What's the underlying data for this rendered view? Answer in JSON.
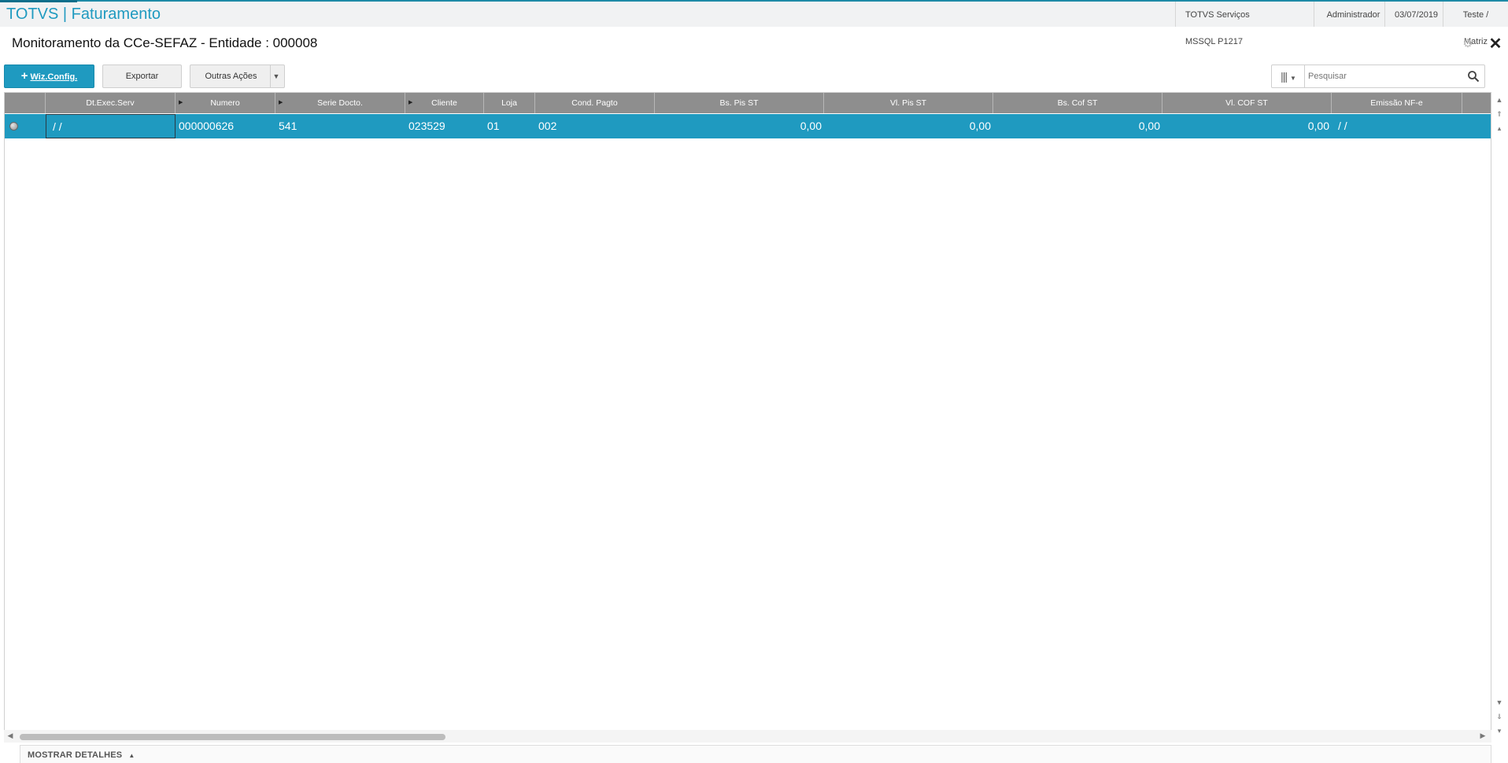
{
  "app": {
    "title": "TOTVS | Faturamento",
    "server": "TOTVS Serviços MSSQL P1217",
    "user": "Administrador",
    "date": "03/07/2019",
    "branch": "Teste / Matriz"
  },
  "page": {
    "title": "Monitoramento da CCe-SEFAZ - Entidade : 000008"
  },
  "toolbar": {
    "wiz_config": "Wiz.Config.",
    "exportar": "Exportar",
    "outras_acoes": "Outras Ações"
  },
  "search": {
    "placeholder": "Pesquisar"
  },
  "grid": {
    "columns": [
      "",
      "Dt.Exec.Serv",
      "Numero",
      "Serie Docto.",
      "Cliente",
      "Loja",
      "Cond. Pagto",
      "Bs. Pis ST",
      "Vl. Pis ST",
      "Bs. Cof ST",
      "Vl. COF ST",
      "Emissão NF-e"
    ],
    "rows": [
      {
        "dt_exec_serv": " /  /",
        "numero": "000000626",
        "serie": "541",
        "cliente": "023529",
        "loja": "01",
        "cond_pagto": "002",
        "bs_pis_st": "0,00",
        "vl_pis_st": "0,00",
        "bs_cof_st": "0,00",
        "vl_cof_st": "0,00",
        "emissao_nfe": " /  /"
      }
    ]
  },
  "footer": {
    "details": "MOSTRAR DETALHES"
  },
  "colors": {
    "accent": "#1f9ac0",
    "header": "#8e8e8e"
  }
}
